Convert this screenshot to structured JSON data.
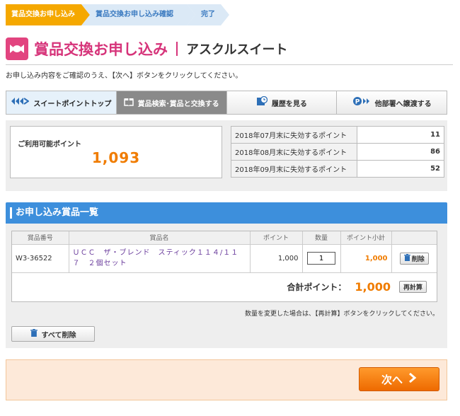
{
  "steps": [
    "賞品交換お申し込み",
    "賞品交換お申し込み確認",
    "完了"
  ],
  "title": {
    "main": "賞品交換お申し込み",
    "sub": "アスクルスイート",
    "icon": "candy-icon"
  },
  "intro": "お申し込み内容をご確認のうえ、【次へ】ボタンをクリックしてください。",
  "nav": [
    {
      "label": "スイートポイントトップ",
      "icon": "suite-logo-icon"
    },
    {
      "label": "賞品検索･賞品と交換する",
      "icon": "gift-icon"
    },
    {
      "label": "履歴を見る",
      "icon": "history-icon"
    },
    {
      "label": "他部署へ譲渡する",
      "icon": "transfer-icon"
    }
  ],
  "points": {
    "available_label": "ご利用可能ポイント",
    "available_value": "1,093",
    "expiry": [
      {
        "label": "2018年07月末に失効するポイント",
        "value": "11"
      },
      {
        "label": "2018年08月末に失効するポイント",
        "value": "86"
      },
      {
        "label": "2018年09月末に失効するポイント",
        "value": "52"
      }
    ]
  },
  "order": {
    "heading": "お申し込み賞品一覧",
    "columns": [
      "賞品番号",
      "賞品名",
      "ポイント",
      "数量",
      "ポイント小計",
      ""
    ],
    "items": [
      {
        "code": "W3-36522",
        "name": "ＵＣＣ　ザ・ブレンド　スティック１１４/１１７　２個セット",
        "points": "1,000",
        "qty": "1",
        "subtotal": "1,000",
        "delete_label": "削除"
      }
    ],
    "total_label": "合計ポイント：",
    "total_value": "1,000",
    "recalc_label": "再計算",
    "note": "数量を変更した場合は、【再計算】ボタンをクリックしてください。",
    "delete_all_label": "すべて削除"
  },
  "next_label": "次へ",
  "colors": {
    "accent_orange": "#f07c00",
    "brand_pink": "#d6347a",
    "header_blue": "#3d8fdc"
  }
}
